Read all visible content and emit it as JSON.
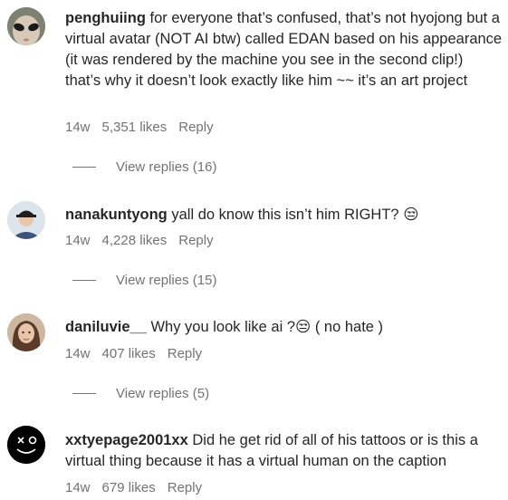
{
  "comments": [
    {
      "username": "penghuiing",
      "text": "for everyone that’s confused, that’s not hyojong but a virtual avatar (NOT AI btw) called EDAN based on his appearance (it was rendered by the machine you see in the second clip!) that’s why it doesn’t look exactly like him ~~ it’s an art project",
      "age": "14w",
      "likes": "5,351 likes",
      "reply_label": "Reply",
      "view_replies": "View replies (16)",
      "avatar_icon": "alien-face-avatar"
    },
    {
      "username": "nanakuntyong",
      "text": "yall do know this isn’t him RIGHT? 😒",
      "age": "14w",
      "likes": "4,228 likes",
      "reply_label": "Reply",
      "view_replies": "View replies (15)",
      "avatar_icon": "person-in-cap-avatar"
    },
    {
      "username": "daniluvie__",
      "text": "Why you look like ai ?😒 ( no hate )",
      "age": "14w",
      "likes": "407 likes",
      "reply_label": "Reply",
      "view_replies": "View replies (5)",
      "avatar_icon": "woman-portrait-avatar"
    },
    {
      "username": "xxtyepage2001xx",
      "text": "Did he get rid of all of his tattoos or is this a virtual thing because it has a virtual human on the caption",
      "age": "14w",
      "likes": "679 likes",
      "reply_label": "Reply",
      "avatar_icon": "smiley-doodle-avatar"
    }
  ]
}
